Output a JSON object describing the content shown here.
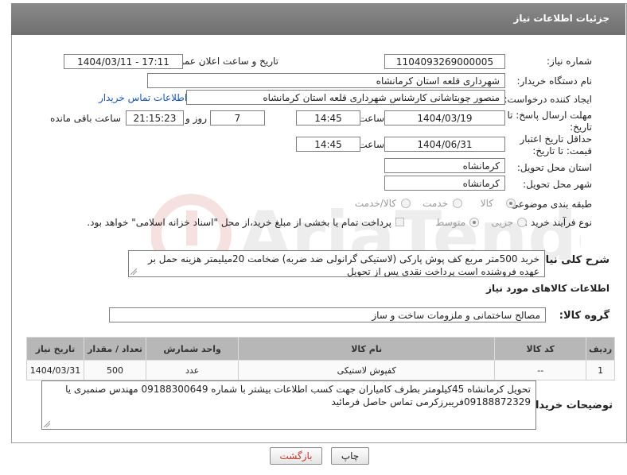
{
  "window": {
    "title": "جزئیات اطلاعات نیاز"
  },
  "form": {
    "need_number_label": "شماره نیاز:",
    "need_number": "1104093269000005",
    "announce_label": "تاریخ و ساعت اعلان عمومی:",
    "announce_value": "1404/03/11 - 17:11",
    "buyer_org_label": "نام دستگاه خریدار:",
    "buyer_org": "شهرداری قلعه استان کرمانشاه",
    "creator_label": "ایجاد کننده درخواست:",
    "creator": "منصور چوبتاشانی کارشناس شهرداری قلعه استان کرمانشاه",
    "buyer_contact_link": "اطلاعات تماس خریدار",
    "reply_deadline_label": "مهلت ارسال پاسخ: تا تاریخ:",
    "reply_date": "1404/03/19",
    "time_label": "ساعت",
    "reply_time": "14:45",
    "days_value": "7",
    "days_label": "روز و",
    "remaining_time": "21:15:23",
    "remaining_label": "ساعت باقی مانده",
    "price_validity_label": "حداقل تاریخ اعتبار قیمت: تا تاریخ:",
    "price_date": "1404/06/31",
    "price_time": "14:45",
    "province_label": "استان محل تحویل:",
    "province": "کرمانشاه",
    "city_label": "شهر محل تحویل:",
    "city": "کرمانشاه",
    "category_label": "طبقه بندی موضوعی:",
    "category_options": [
      "کالا",
      "خدمت",
      "کالا/خدمت"
    ],
    "process_label": "نوع فرآیند خرید :",
    "process_options": [
      "جزیی",
      "متوسط"
    ],
    "payment_note": "پرداخت تمام یا بخشی از مبلغ خرید،از محل \"اسناد خزانه اسلامی\" خواهد بود.",
    "summary_label": "شرح کلی نیاز:",
    "summary_text": "خرید 500متر مربع کف پوش پارکی (لاستیکی گرانولی ضد ضربه) ضخامت 20میلیمتر هزینه حمل بر عهده فروشنده است پرداخت نقدی پس از تحویل",
    "goods_info_title": "اطلاعات کالاهای مورد نیاز",
    "goods_group_label": "گروه کالا:",
    "goods_group": "مصالح ساختمانی و ملزومات ساخت و ساز"
  },
  "table": {
    "headers": [
      "ردیف",
      "کد کالا",
      "نام کالا",
      "واحد شمارش",
      "تعداد / مقدار",
      "تاریخ نیاز"
    ],
    "rows": [
      {
        "row": "1",
        "code": "--",
        "name": "کفپوش لاستیکی",
        "unit": "عدد",
        "qty": "500",
        "date": "1404/03/31"
      }
    ]
  },
  "buyer_notes_label": "توضیحات خریدار:",
  "buyer_notes": "تحویل کرمانشاه 45کیلومتر بطرف کامیاران جهت کسب اطلاعات بیشتر با شماره 09188300649 مهندس صنمبری یا 09188872329فریبرزکرمی تماس حاصل فرمائید",
  "buttons": {
    "print": "چاپ",
    "back": "بازگشت"
  },
  "colors": {
    "title_bar": "#7c7c7c",
    "link": "#1a56b8",
    "back_button_text": "#c0392b"
  }
}
